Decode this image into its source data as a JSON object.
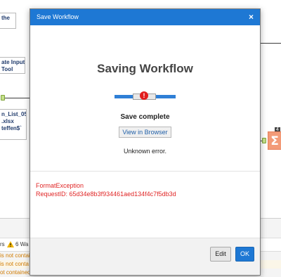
{
  "canvas": {
    "tools": [
      {
        "label": "the",
        "style": "blue"
      },
      {
        "label": "ate Input\nTool",
        "style": "blue"
      },
      {
        "label": "n_List_05\n.xlsx\nteffen$`",
        "style": "blue"
      }
    ],
    "sum_badge": "Σ"
  },
  "results": {
    "toolbar": {
      "errors_fragment": "rs",
      "warnings_label": "6 Wa"
    },
    "warnings": [
      "is not contai",
      "is not conta",
      "ot contained in the record."
    ]
  },
  "dialog": {
    "title": "Save Workflow",
    "close_label": "×",
    "heading": "Saving Workflow",
    "progress_icon": "!",
    "status": "Save complete",
    "view_button": "View in Browser",
    "message": "Unknown error.",
    "exception_lines": [
      "FormatException",
      "RequestID: 65d34e8b3f934461aed134f4c7f5db3d"
    ],
    "edit_button": "Edit",
    "ok_button": "OK"
  },
  "colors": {
    "accent": "#1e78d4",
    "error": "#e02525",
    "warning": "#d07b00"
  },
  "icons": [
    "close-icon",
    "error-icon",
    "sum-tool-icon",
    "warning-icon"
  ]
}
